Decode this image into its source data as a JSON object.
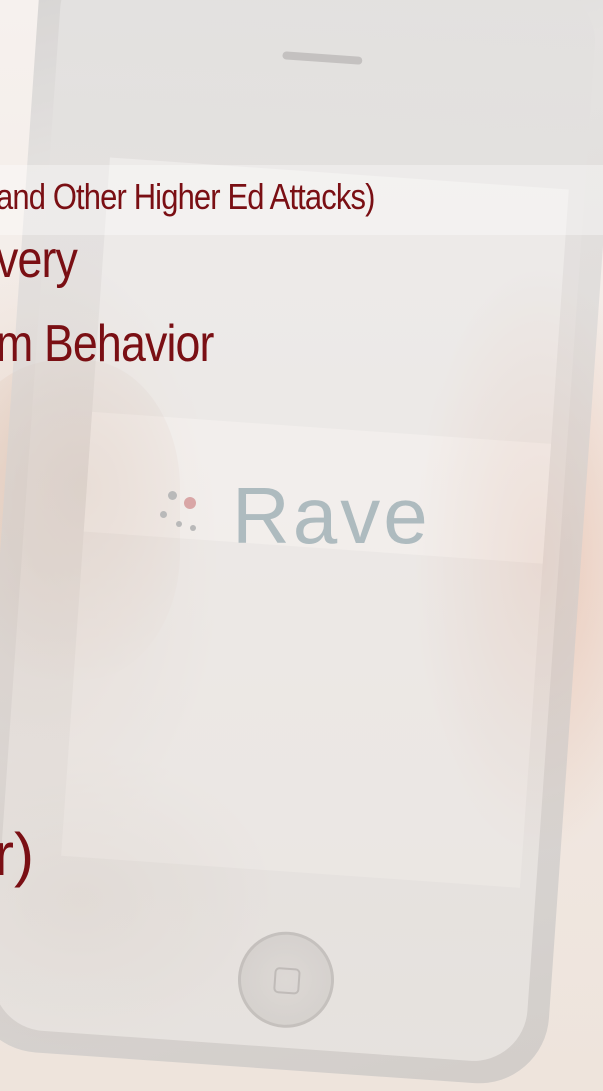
{
  "slide": {
    "lines": [
      "and Other Higher Ed Attacks)",
      "very",
      "m Behavior",
      "r)"
    ]
  },
  "background": {
    "logo_word": "Rave",
    "colors": {
      "text": "#7a0f14",
      "background": "#f5efea",
      "phone": "#cfcfcf"
    }
  }
}
